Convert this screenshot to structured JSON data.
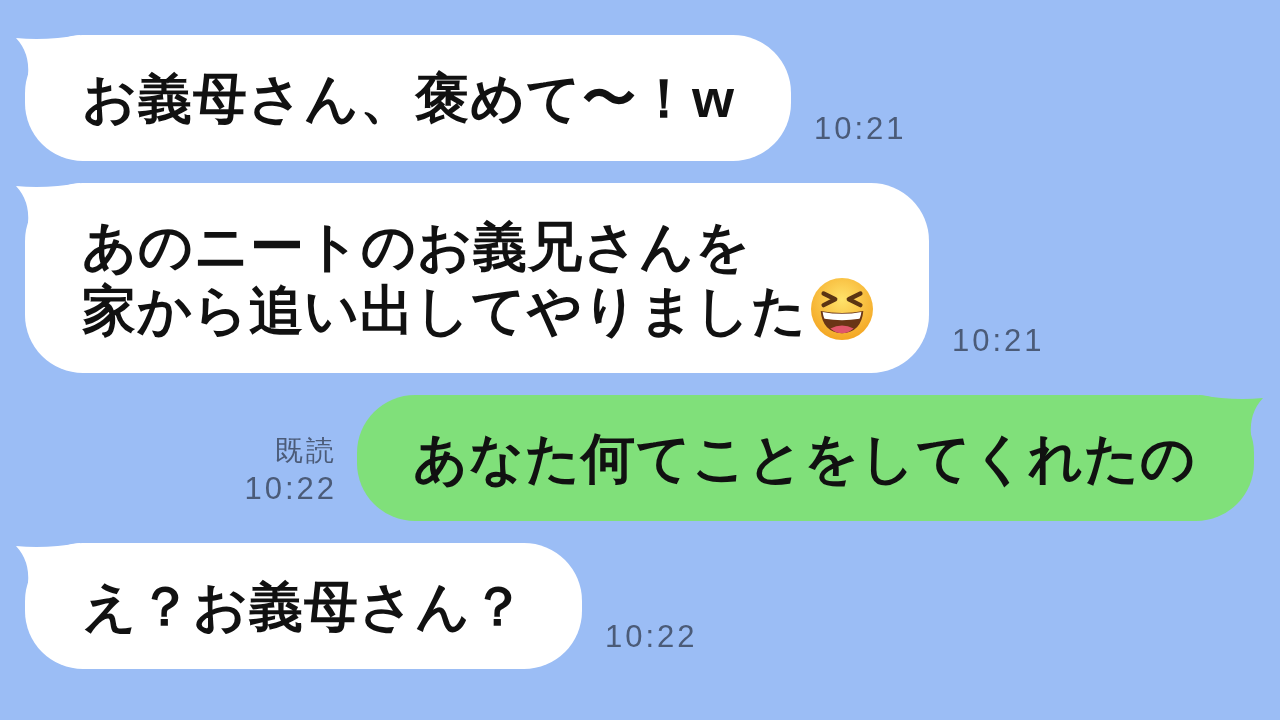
{
  "messages": [
    {
      "kind": "received",
      "lines": [
        "お義母さん、褒めて〜！w"
      ],
      "time": "10:21"
    },
    {
      "kind": "received",
      "lines": [
        "あのニートのお義兄さんを",
        "家から追い出してやりました"
      ],
      "emoji": true,
      "time": "10:21"
    },
    {
      "kind": "sent",
      "read_label": "既読",
      "lines": [
        "あなた何てことをしてくれたの"
      ],
      "time": "10:22"
    },
    {
      "kind": "received",
      "lines": [
        "え？お義母さん？"
      ],
      "time": "10:22"
    }
  ]
}
